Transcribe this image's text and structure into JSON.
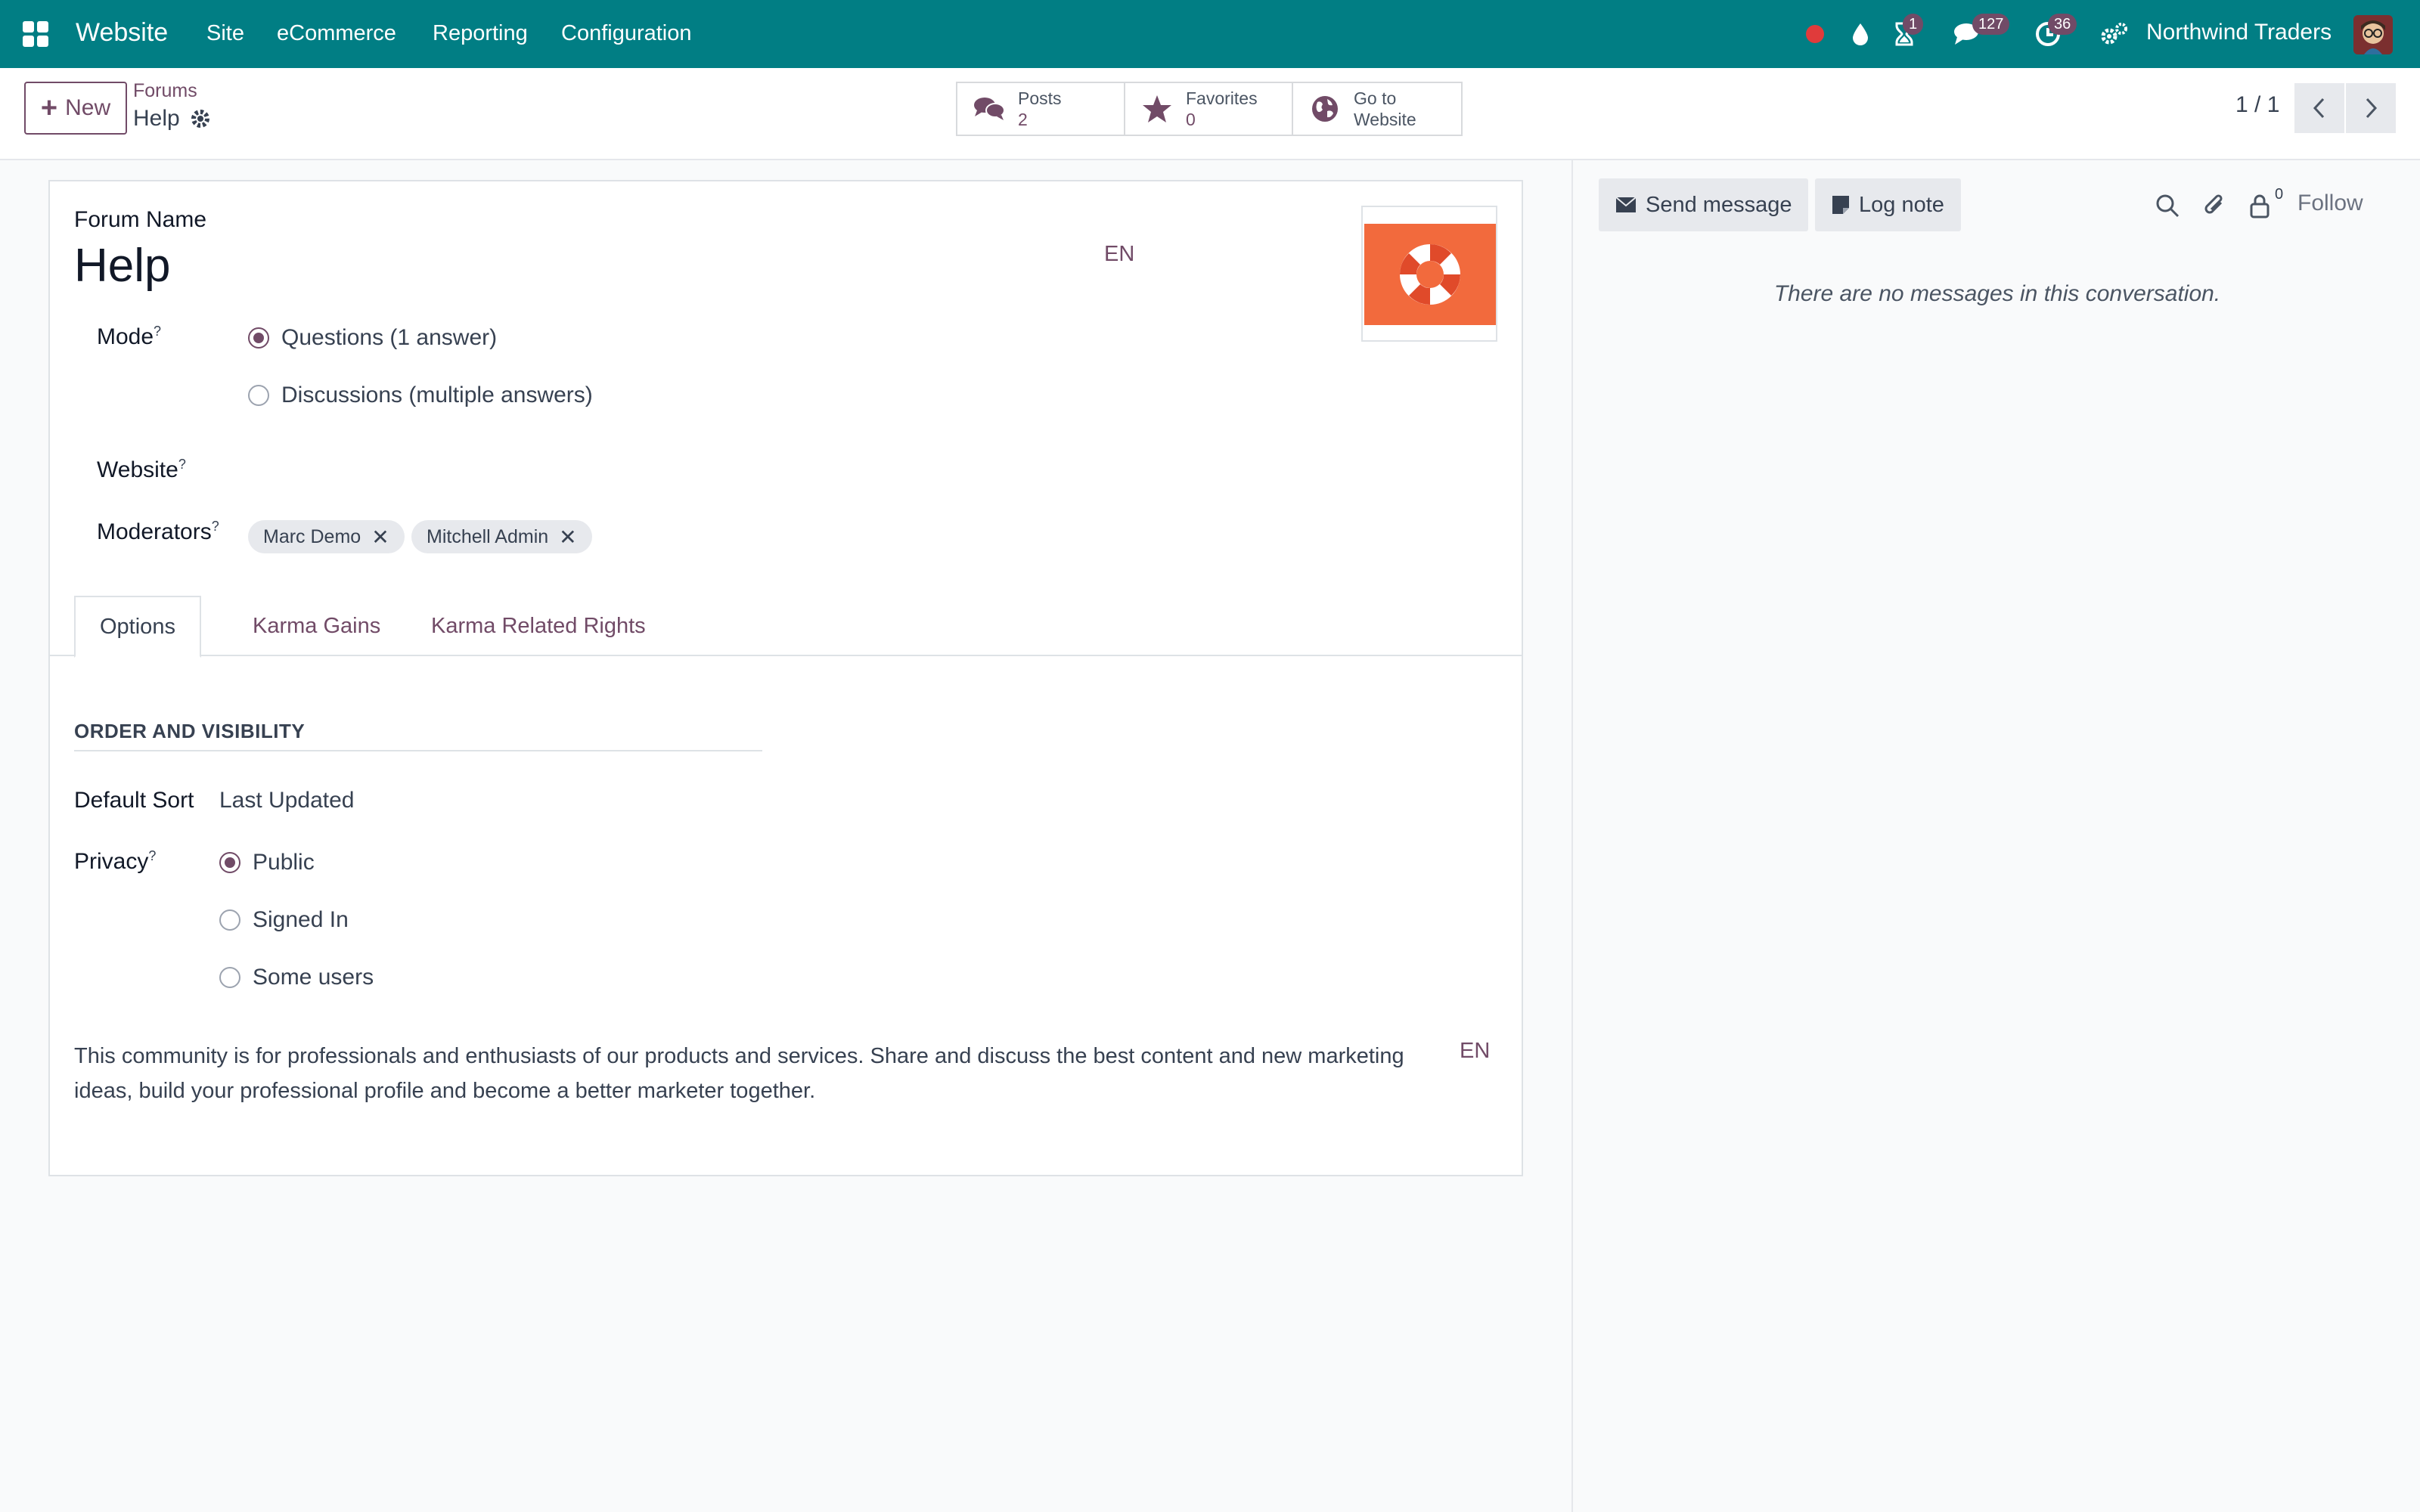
{
  "navbar": {
    "brand": "Website",
    "menu": [
      "Site",
      "eCommerce",
      "Reporting",
      "Configuration"
    ],
    "badges": {
      "activity": "1",
      "messages": "127",
      "clock": "36"
    },
    "company": "Northwind Traders",
    "color": "#017e84"
  },
  "control": {
    "new_label": "New",
    "breadcrumb_parent": "Forums",
    "breadcrumb_current": "Help",
    "smart_buttons": {
      "posts_label": "Posts",
      "posts_value": "2",
      "favorites_label": "Favorites",
      "favorites_value": "0",
      "website_label_1": "Go to",
      "website_label_2": "Website"
    },
    "pager": "1 / 1"
  },
  "form": {
    "forum_name_label": "Forum Name",
    "forum_name": "Help",
    "lang": "EN",
    "mode_label": "Mode",
    "mode_options": [
      "Questions (1 answer)",
      "Discussions (multiple answers)"
    ],
    "mode_selected": "Questions (1 answer)",
    "website_label": "Website",
    "moderators_label": "Moderators",
    "moderators": [
      "Marc Demo",
      "Mitchell Admin"
    ],
    "help_mark": "?",
    "tabs": [
      "Options",
      "Karma Gains",
      "Karma Related Rights"
    ],
    "active_tab": "Options",
    "section_title": "ORDER AND VISIBILITY",
    "default_sort_label": "Default Sort",
    "default_sort": "Last Updated",
    "privacy_label": "Privacy",
    "privacy_options": [
      "Public",
      "Signed In",
      "Some users"
    ],
    "privacy_selected": "Public",
    "description": "This community is for professionals and enthusiasts of our products and services. Share and discuss the best content and new marketing ideas, build your professional profile and become a better marketer together.",
    "description_lang": "EN",
    "accent": "#714b67"
  },
  "chatter": {
    "send_message": "Send message",
    "log_note": "Log note",
    "followers": "0",
    "follow": "Follow",
    "empty": "There are no messages in this conversation."
  }
}
